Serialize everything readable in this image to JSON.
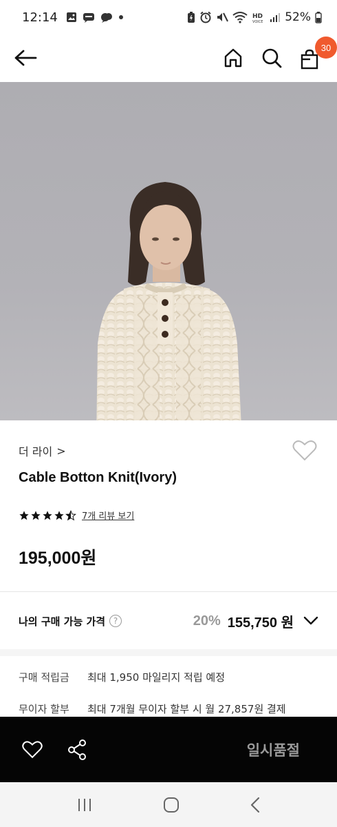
{
  "status_bar": {
    "time": "12:14",
    "battery": "52%",
    "left_icons": [
      "gallery-icon",
      "sms-icon",
      "messenger-icon",
      "dot-icon"
    ],
    "right_icons": [
      "battery-saver-icon",
      "alarm-icon",
      "mute-icon",
      "wifi-icon",
      "hd-voice-icon",
      "signal-icon",
      "battery-icon"
    ]
  },
  "top_nav": {
    "back_icon": "arrow-left-icon",
    "home_icon": "home-icon",
    "search_icon": "search-icon",
    "cart_icon": "shopping-bag-icon",
    "cart_count": "30"
  },
  "product": {
    "brand": "더 라이",
    "brand_chevron": ">",
    "name": "Cable Botton Knit(Ivory)",
    "rating": 4.5,
    "review_link": "7개 리뷰 보기",
    "price": "195,000원"
  },
  "my_price": {
    "label": "나의 구매 가능 가격",
    "help": "?",
    "discount": "20%",
    "discount_price": "155,750 원"
  },
  "benefits": [
    {
      "label": "구매 적립금",
      "value": "최대 1,950 마일리지 적립 예정"
    },
    {
      "label": "무이자 할부",
      "value": "최대 7개월 무이자 할부 시 월 27,857원 결제"
    }
  ],
  "purchase_bar": {
    "sold_out_label": "일시품절"
  },
  "colors": {
    "accent_badge": "#f05a2e",
    "purchase_bar_bg": "#050505",
    "sold_out_text": "#9a9a9a"
  }
}
